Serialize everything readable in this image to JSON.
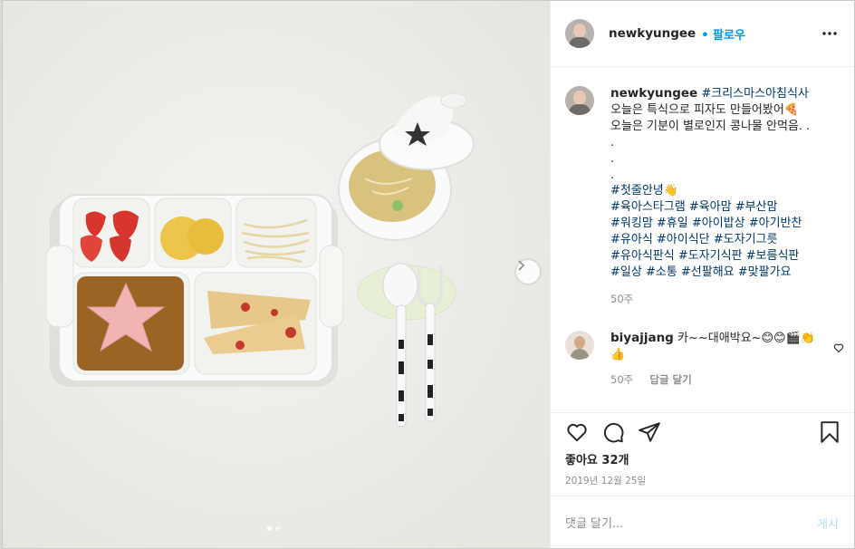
{
  "post": {
    "username": "newkyungee",
    "follow_label": "• 팔로우",
    "caption": {
      "hashtag_title": "#크리스마스아침식사",
      "lines": [
        "오늘은 특식으로 피자도 만들어봤어🍕",
        "오늘은 기분이 별로인지 콩나물 안먹음. .",
        ".",
        ".",
        "."
      ],
      "first_tooth": "#첫줄안녕👋",
      "hashtag_lines": [
        "#육아스타그램 #육아맘 #부산맘",
        "#워킹맘 #휴일 #아이밥상 #아기반찬",
        "#유아식 #아이식단 #도자기그릇",
        "#유아식판식 #도자기식판 #보름식판",
        "#일상 #소통 #선팔해요 #맞팔가요"
      ],
      "age": "50주"
    },
    "comment": {
      "username": "biyajjang",
      "text": "카~~대애박요~😊😊🎬👏👍",
      "age": "50주",
      "reply_label": "답글 달기"
    },
    "likes": "좋아요 32개",
    "date": "2019년 12월 25일",
    "comment_placeholder": "댓글 달기...",
    "post_label": "게시"
  },
  "colors": {
    "accent": "#0095f6",
    "hashtag": "#00376b",
    "muted": "#8e8e8e"
  },
  "icons": [
    "more-icon",
    "heart-icon",
    "comment-icon",
    "share-icon",
    "bookmark-icon",
    "chevron-right-icon"
  ],
  "carousel": {
    "slides": 2,
    "current": 1
  }
}
